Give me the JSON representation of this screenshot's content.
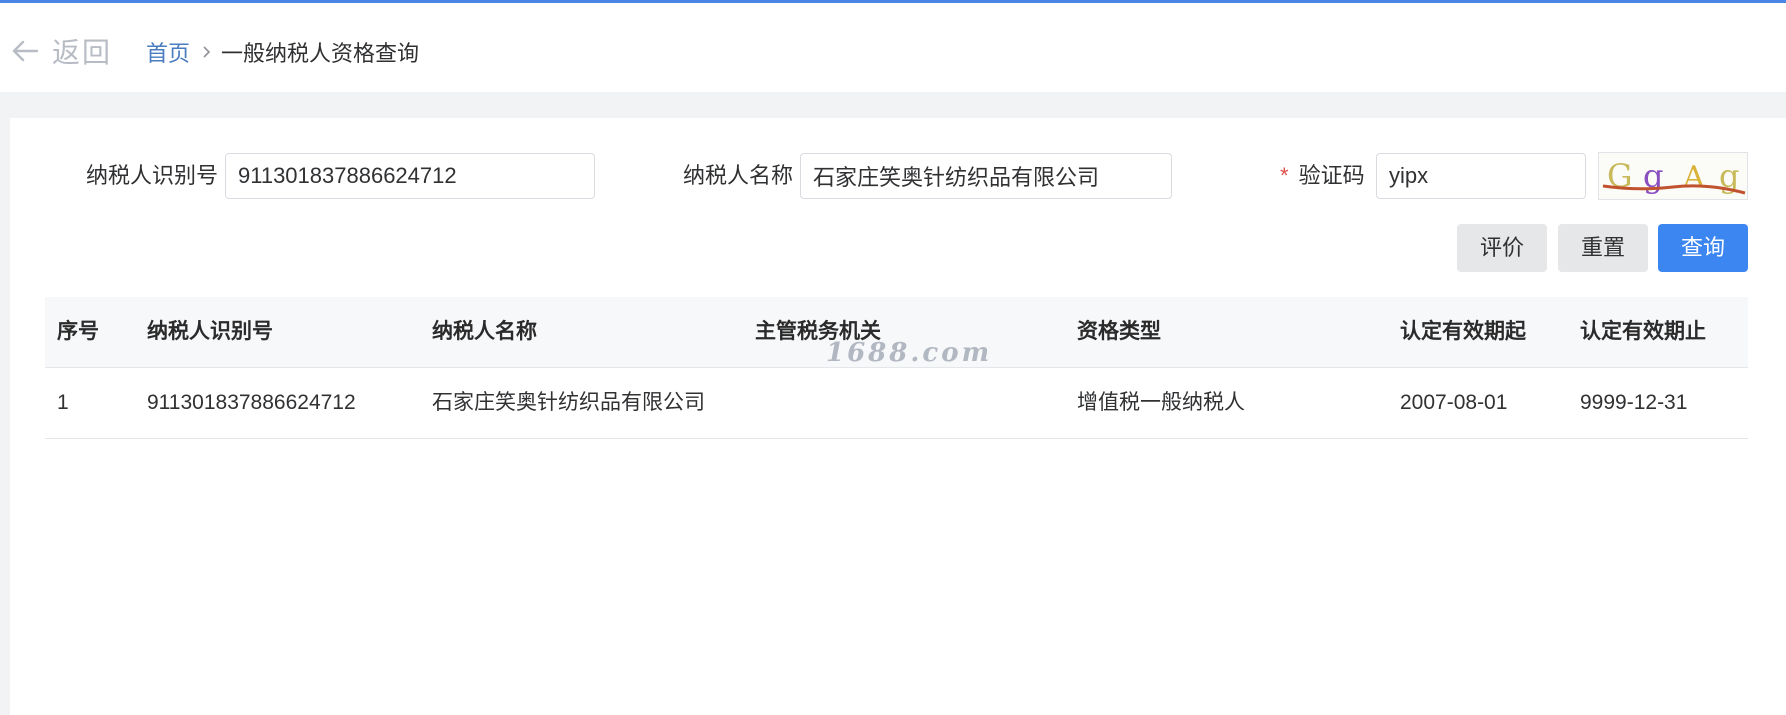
{
  "nav": {
    "back_label": "返回",
    "breadcrumb_home": "首页",
    "breadcrumb_current": "一般纳税人资格查询"
  },
  "form": {
    "taxpayer_id_label": "纳税人识别号",
    "taxpayer_id_value": "911301837886624712",
    "taxpayer_name_label": "纳税人名称",
    "taxpayer_name_value": "石家庄笑奥针纺织品有限公司",
    "captcha_label": "验证码",
    "captcha_required_mark": "*",
    "captcha_value": "yipx",
    "captcha_image_text": [
      "G",
      "g",
      "A",
      "g"
    ]
  },
  "buttons": {
    "evaluate": "评价",
    "reset": "重置",
    "query": "查询"
  },
  "table": {
    "headers": [
      "序号",
      "纳税人识别号",
      "纳税人名称",
      "主管税务机关",
      "资格类型",
      "认定有效期起",
      "认定有效期止"
    ],
    "rows": [
      [
        "1",
        "911301837886624712",
        "石家庄笑奥针纺织品有限公司",
        "",
        "增值税一般纳税人",
        "2007-08-01",
        "9999-12-31"
      ]
    ]
  },
  "watermark": "1688.com",
  "colors": {
    "accent": "#3b86f0",
    "top_bar": "#4a86e8",
    "link": "#4a7cc0",
    "required": "#e0504a"
  }
}
